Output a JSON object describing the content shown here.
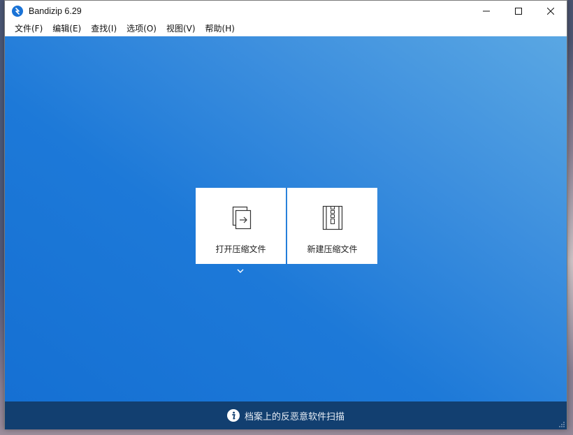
{
  "window": {
    "title": "Bandizip 6.29"
  },
  "menu": {
    "items": [
      "文件(F)",
      "编辑(E)",
      "查找(I)",
      "选项(O)",
      "视图(V)",
      "帮助(H)"
    ]
  },
  "actions": {
    "open_label": "打开压缩文件",
    "new_label": "新建压缩文件"
  },
  "statusbar": {
    "text": "档案上的反恶意软件扫描"
  },
  "icons": {
    "app": "bandizip-logo-icon",
    "minimize": "minimize-icon",
    "maximize": "maximize-icon",
    "close": "close-icon",
    "open": "open-archive-icon",
    "new": "new-archive-icon",
    "dropdown": "chevron-down-icon",
    "info": "info-icon"
  },
  "colors": {
    "accent": "#1a73d6",
    "status_bg": "#123f70"
  }
}
